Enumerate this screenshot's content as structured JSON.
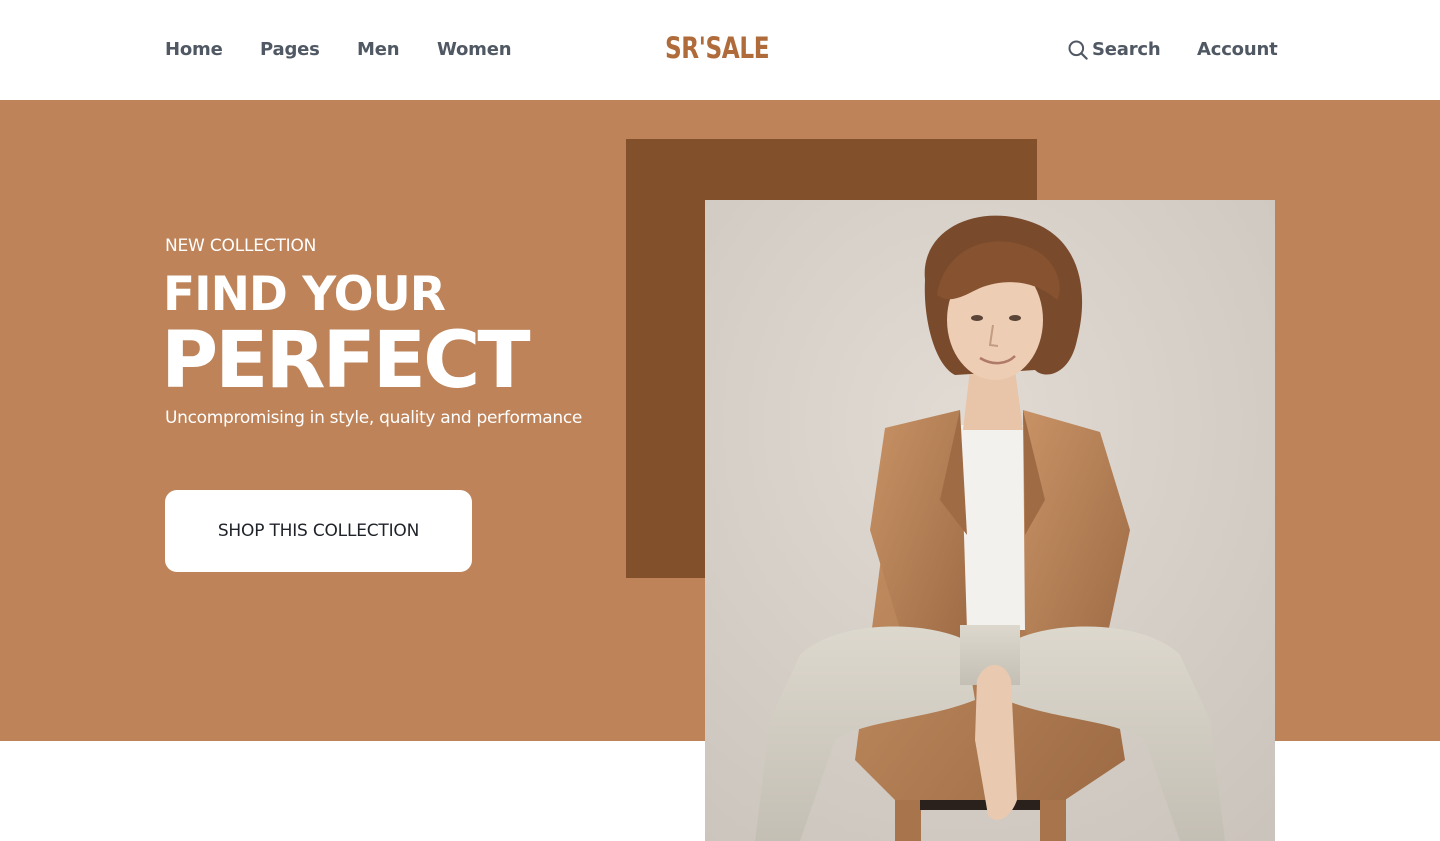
{
  "colors": {
    "brand": "#B06B3B",
    "hero_bg": "#BE8359",
    "hero_block": "#82502A",
    "nav_text": "#505863",
    "cta_text": "#1F2329",
    "white": "#FFFFFF"
  },
  "header": {
    "nav_left": [
      {
        "label": "Home"
      },
      {
        "label": "Pages"
      },
      {
        "label": "Men"
      },
      {
        "label": "Women"
      }
    ],
    "logo": "SR'SALE",
    "search": {
      "label": "Search",
      "icon": "search-icon"
    },
    "account": {
      "label": "Account"
    }
  },
  "hero": {
    "eyebrow": "NEW COLLECTION",
    "headline_line1": "FIND YOUR",
    "headline_line2": "PERFECT",
    "subheading": "Uncompromising in style, quality and performance",
    "cta_label": "SHOP THIS COLLECTION"
  }
}
